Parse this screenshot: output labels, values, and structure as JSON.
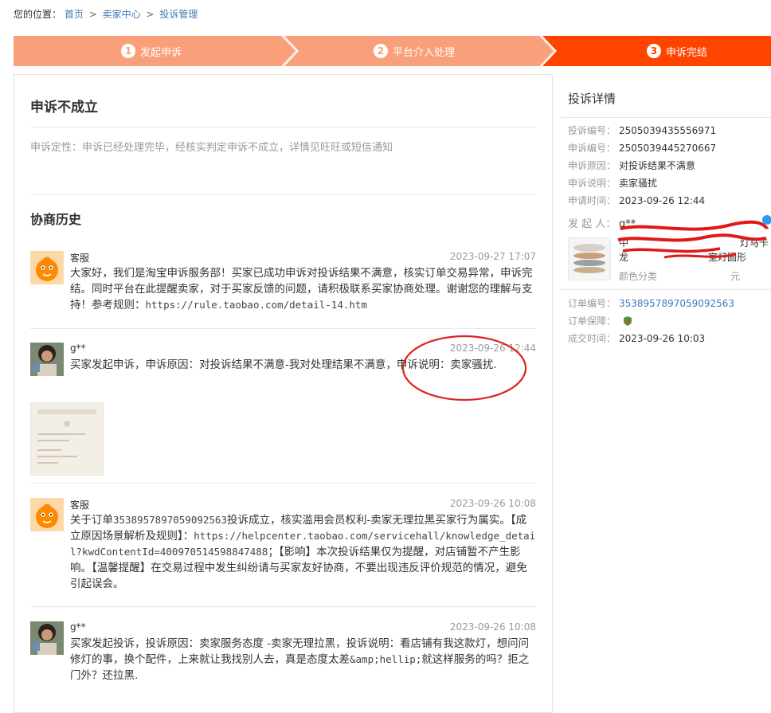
{
  "breadcrumb": {
    "prefix": "您的位置：",
    "items": [
      "首页",
      "卖家中心",
      "投诉管理"
    ],
    "separator": ">"
  },
  "steps": [
    {
      "num": "1",
      "label": "发起申诉"
    },
    {
      "num": "2",
      "label": "平台介入处理"
    },
    {
      "num": "3",
      "label": "申诉完结"
    }
  ],
  "colors": {
    "step_done": "#f9a07a",
    "step_current": "#ff4400",
    "link": "#3c7bb8"
  },
  "result": {
    "title": "申诉不成立",
    "conclusion_label": "申诉定性：",
    "conclusion_text": "申诉已经处理完毕，经核实判定申诉不成立，详情见旺旺或短信通知"
  },
  "history": {
    "title": "协商历史",
    "messages": [
      {
        "name": "客服",
        "time": "2023-09-27 17:07",
        "avatar": "taobao-mascot-avatar",
        "text": "大家好，我们是淘宝申诉服务部！买家已成功申诉对投诉结果不满意，核实订单交易异常，申诉完结。同时平台在此提醒卖家，对于买家反馈的问题，请积极联系买家协商处理。谢谢您的理解与支持！参考规则：",
        "link": "https://rule.taobao.com/detail-14.htm"
      },
      {
        "name": "g**",
        "time": "2023-09-26 12:44",
        "avatar": "user-photo-avatar",
        "text": "买家发起申诉，申诉原因：对投诉结果不满意-我对处理结果不满意，申诉说明：卖家骚扰."
      },
      {
        "name": "客服",
        "time": "2023-09-26 10:08",
        "avatar": "taobao-mascot-avatar",
        "text_a": "关于订单",
        "order": "3538957897059092563",
        "text_b": "投诉成立，核实滥用会员权利-卖家无理拉黑买家行为属实。【成立原因场景解析及规则】：",
        "link": "https://helpcenter.taobao.com/servicehall/knowledge_detail?kwdContentId=400970514598847488",
        "text_c": "；【影响】本次投诉结果仅为提醒，对店铺暂不产生影响。【温馨提醒】在交易过程中发生纠纷请与买家友好协商，不要出现违反评价规范的情况，避免引起误会。"
      },
      {
        "name": "g**",
        "time": "2023-09-26 10:08",
        "avatar": "user-photo-avatar",
        "text_a": "买家发起投诉，投诉原因：卖家服务态度 -卖家无理拉黑，投诉说明：看店铺有我这款灯，想问问修灯的事，换个配件，上来就让我找别人去，真是态度太差",
        "entity": "&amp;hellip;",
        "text_b": "就这样服务的吗？拒之门外？还拉黑."
      }
    ]
  },
  "details": {
    "title": "投诉详情",
    "complaint_no_label": "投诉编号：",
    "complaint_no": "2505039435556971",
    "appeal_no_label": "申诉编号：",
    "appeal_no": "2505039445270667",
    "appeal_reason_label": "申诉原因：",
    "appeal_reason": "对投诉结果不满意",
    "appeal_desc_label": "申诉说明：",
    "appeal_desc": "卖家骚扰",
    "apply_time_label": "申请时间：",
    "apply_time": "2023-09-26 12:44",
    "initiator_label": "发 起 人：",
    "initiator": "g**",
    "product_title_1": "中",
    "product_title_2": "灯马卡",
    "product_title_3": "龙",
    "product_title_4": "室灯圆形",
    "product_sku": "颜色分类",
    "product_sku_2": "元",
    "order_no_label": "订单编号：",
    "order_no": "3538957897059092563",
    "guarantee_label": "订单保障：",
    "deal_time_label": "成交时间：",
    "deal_time": "2023-09-26 10:03"
  }
}
